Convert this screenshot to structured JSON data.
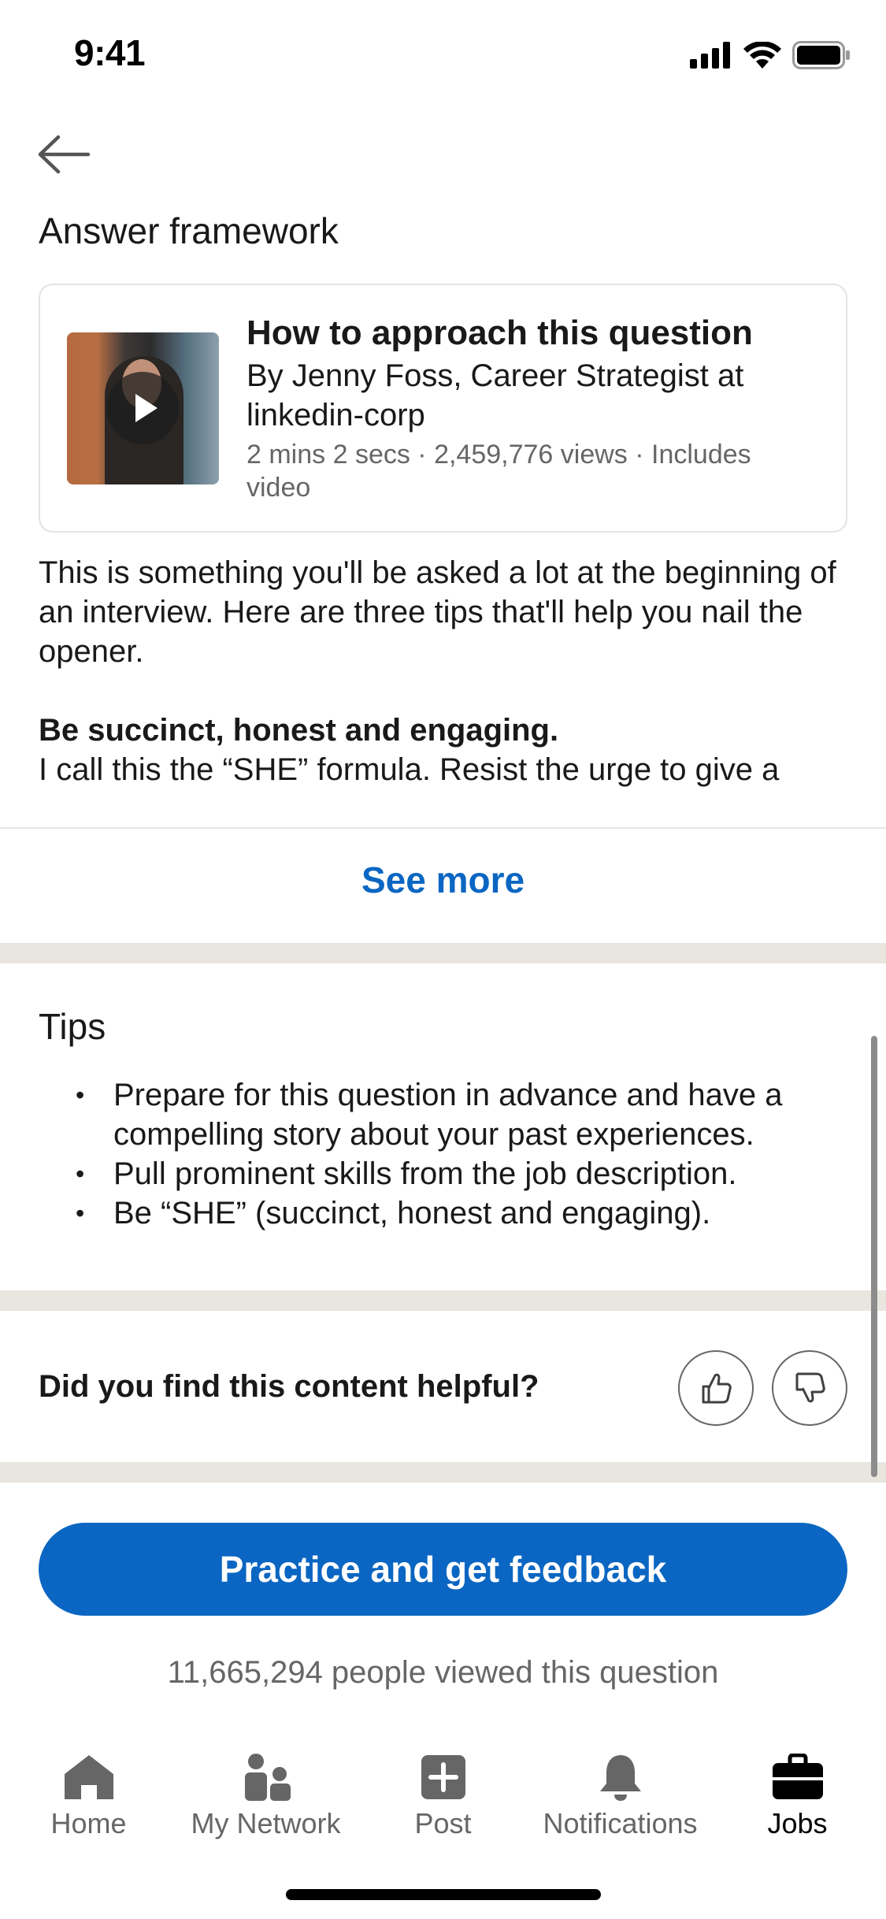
{
  "status_bar": {
    "time": "9:41"
  },
  "page": {
    "back_icon": "arrow-left-icon",
    "section_title": "Answer framework"
  },
  "video_card": {
    "title": "How to approach this question",
    "author": "By Jenny Foss, Career Strategist at linkedin-corp",
    "meta": "2 mins 2 secs · 2,459,776 views · Includes video"
  },
  "description": {
    "intro": "This is something you'll be asked a lot at the beginning of an interview. Here are three tips that'll help you nail the opener.",
    "heading": "Be succinct, honest and engaging.",
    "truncated_line": "I call this the “SHE” formula. Resist the urge to give a",
    "see_more": "See more"
  },
  "tips": {
    "title": "Tips",
    "items": [
      "Prepare for this question in advance and have a compelling story about your past experiences.",
      "Pull prominent skills from the job description.",
      "Be “SHE” (succinct, honest and engaging)."
    ]
  },
  "feedback": {
    "question": "Did you find this content helpful?",
    "like_icon": "thumbs-up-icon",
    "dislike_icon": "thumbs-down-icon"
  },
  "cta": {
    "label": "Practice and get feedback",
    "views": "11,665,294 people viewed this question"
  },
  "bottom_nav": {
    "items": [
      {
        "label": "Home",
        "icon": "home-icon"
      },
      {
        "label": "My Network",
        "icon": "my-network-icon"
      },
      {
        "label": "Post",
        "icon": "post-icon"
      },
      {
        "label": "Notifications",
        "icon": "bell-icon"
      },
      {
        "label": "Jobs",
        "icon": "briefcase-icon"
      }
    ],
    "active": "Jobs"
  },
  "colors": {
    "accent": "#0a66c2",
    "band": "#e9e5df",
    "muted_text": "#666666"
  }
}
